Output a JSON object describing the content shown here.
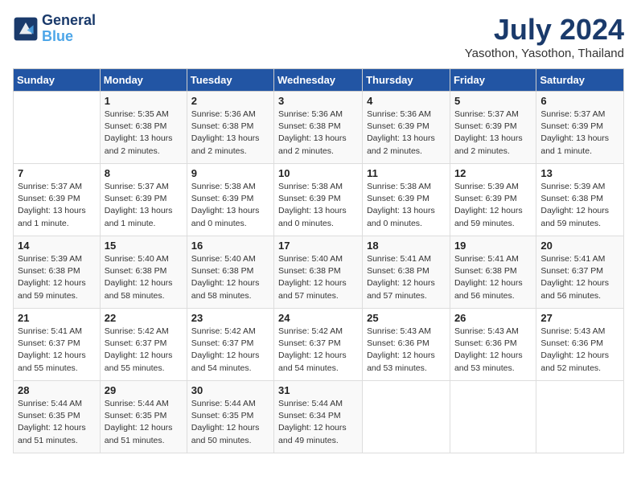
{
  "logo": {
    "text_general": "General",
    "text_blue": "Blue"
  },
  "title": "July 2024",
  "subtitle": "Yasothon, Yasothon, Thailand",
  "days_header": [
    "Sunday",
    "Monday",
    "Tuesday",
    "Wednesday",
    "Thursday",
    "Friday",
    "Saturday"
  ],
  "weeks": [
    [
      {
        "num": "",
        "info": ""
      },
      {
        "num": "1",
        "info": "Sunrise: 5:35 AM\nSunset: 6:38 PM\nDaylight: 13 hours\nand 2 minutes."
      },
      {
        "num": "2",
        "info": "Sunrise: 5:36 AM\nSunset: 6:38 PM\nDaylight: 13 hours\nand 2 minutes."
      },
      {
        "num": "3",
        "info": "Sunrise: 5:36 AM\nSunset: 6:38 PM\nDaylight: 13 hours\nand 2 minutes."
      },
      {
        "num": "4",
        "info": "Sunrise: 5:36 AM\nSunset: 6:39 PM\nDaylight: 13 hours\nand 2 minutes."
      },
      {
        "num": "5",
        "info": "Sunrise: 5:37 AM\nSunset: 6:39 PM\nDaylight: 13 hours\nand 2 minutes."
      },
      {
        "num": "6",
        "info": "Sunrise: 5:37 AM\nSunset: 6:39 PM\nDaylight: 13 hours\nand 1 minute."
      }
    ],
    [
      {
        "num": "7",
        "info": "Sunrise: 5:37 AM\nSunset: 6:39 PM\nDaylight: 13 hours\nand 1 minute."
      },
      {
        "num": "8",
        "info": "Sunrise: 5:37 AM\nSunset: 6:39 PM\nDaylight: 13 hours\nand 1 minute."
      },
      {
        "num": "9",
        "info": "Sunrise: 5:38 AM\nSunset: 6:39 PM\nDaylight: 13 hours\nand 0 minutes."
      },
      {
        "num": "10",
        "info": "Sunrise: 5:38 AM\nSunset: 6:39 PM\nDaylight: 13 hours\nand 0 minutes."
      },
      {
        "num": "11",
        "info": "Sunrise: 5:38 AM\nSunset: 6:39 PM\nDaylight: 13 hours\nand 0 minutes."
      },
      {
        "num": "12",
        "info": "Sunrise: 5:39 AM\nSunset: 6:39 PM\nDaylight: 12 hours\nand 59 minutes."
      },
      {
        "num": "13",
        "info": "Sunrise: 5:39 AM\nSunset: 6:38 PM\nDaylight: 12 hours\nand 59 minutes."
      }
    ],
    [
      {
        "num": "14",
        "info": "Sunrise: 5:39 AM\nSunset: 6:38 PM\nDaylight: 12 hours\nand 59 minutes."
      },
      {
        "num": "15",
        "info": "Sunrise: 5:40 AM\nSunset: 6:38 PM\nDaylight: 12 hours\nand 58 minutes."
      },
      {
        "num": "16",
        "info": "Sunrise: 5:40 AM\nSunset: 6:38 PM\nDaylight: 12 hours\nand 58 minutes."
      },
      {
        "num": "17",
        "info": "Sunrise: 5:40 AM\nSunset: 6:38 PM\nDaylight: 12 hours\nand 57 minutes."
      },
      {
        "num": "18",
        "info": "Sunrise: 5:41 AM\nSunset: 6:38 PM\nDaylight: 12 hours\nand 57 minutes."
      },
      {
        "num": "19",
        "info": "Sunrise: 5:41 AM\nSunset: 6:38 PM\nDaylight: 12 hours\nand 56 minutes."
      },
      {
        "num": "20",
        "info": "Sunrise: 5:41 AM\nSunset: 6:37 PM\nDaylight: 12 hours\nand 56 minutes."
      }
    ],
    [
      {
        "num": "21",
        "info": "Sunrise: 5:41 AM\nSunset: 6:37 PM\nDaylight: 12 hours\nand 55 minutes."
      },
      {
        "num": "22",
        "info": "Sunrise: 5:42 AM\nSunset: 6:37 PM\nDaylight: 12 hours\nand 55 minutes."
      },
      {
        "num": "23",
        "info": "Sunrise: 5:42 AM\nSunset: 6:37 PM\nDaylight: 12 hours\nand 54 minutes."
      },
      {
        "num": "24",
        "info": "Sunrise: 5:42 AM\nSunset: 6:37 PM\nDaylight: 12 hours\nand 54 minutes."
      },
      {
        "num": "25",
        "info": "Sunrise: 5:43 AM\nSunset: 6:36 PM\nDaylight: 12 hours\nand 53 minutes."
      },
      {
        "num": "26",
        "info": "Sunrise: 5:43 AM\nSunset: 6:36 PM\nDaylight: 12 hours\nand 53 minutes."
      },
      {
        "num": "27",
        "info": "Sunrise: 5:43 AM\nSunset: 6:36 PM\nDaylight: 12 hours\nand 52 minutes."
      }
    ],
    [
      {
        "num": "28",
        "info": "Sunrise: 5:44 AM\nSunset: 6:35 PM\nDaylight: 12 hours\nand 51 minutes."
      },
      {
        "num": "29",
        "info": "Sunrise: 5:44 AM\nSunset: 6:35 PM\nDaylight: 12 hours\nand 51 minutes."
      },
      {
        "num": "30",
        "info": "Sunrise: 5:44 AM\nSunset: 6:35 PM\nDaylight: 12 hours\nand 50 minutes."
      },
      {
        "num": "31",
        "info": "Sunrise: 5:44 AM\nSunset: 6:34 PM\nDaylight: 12 hours\nand 49 minutes."
      },
      {
        "num": "",
        "info": ""
      },
      {
        "num": "",
        "info": ""
      },
      {
        "num": "",
        "info": ""
      }
    ]
  ]
}
